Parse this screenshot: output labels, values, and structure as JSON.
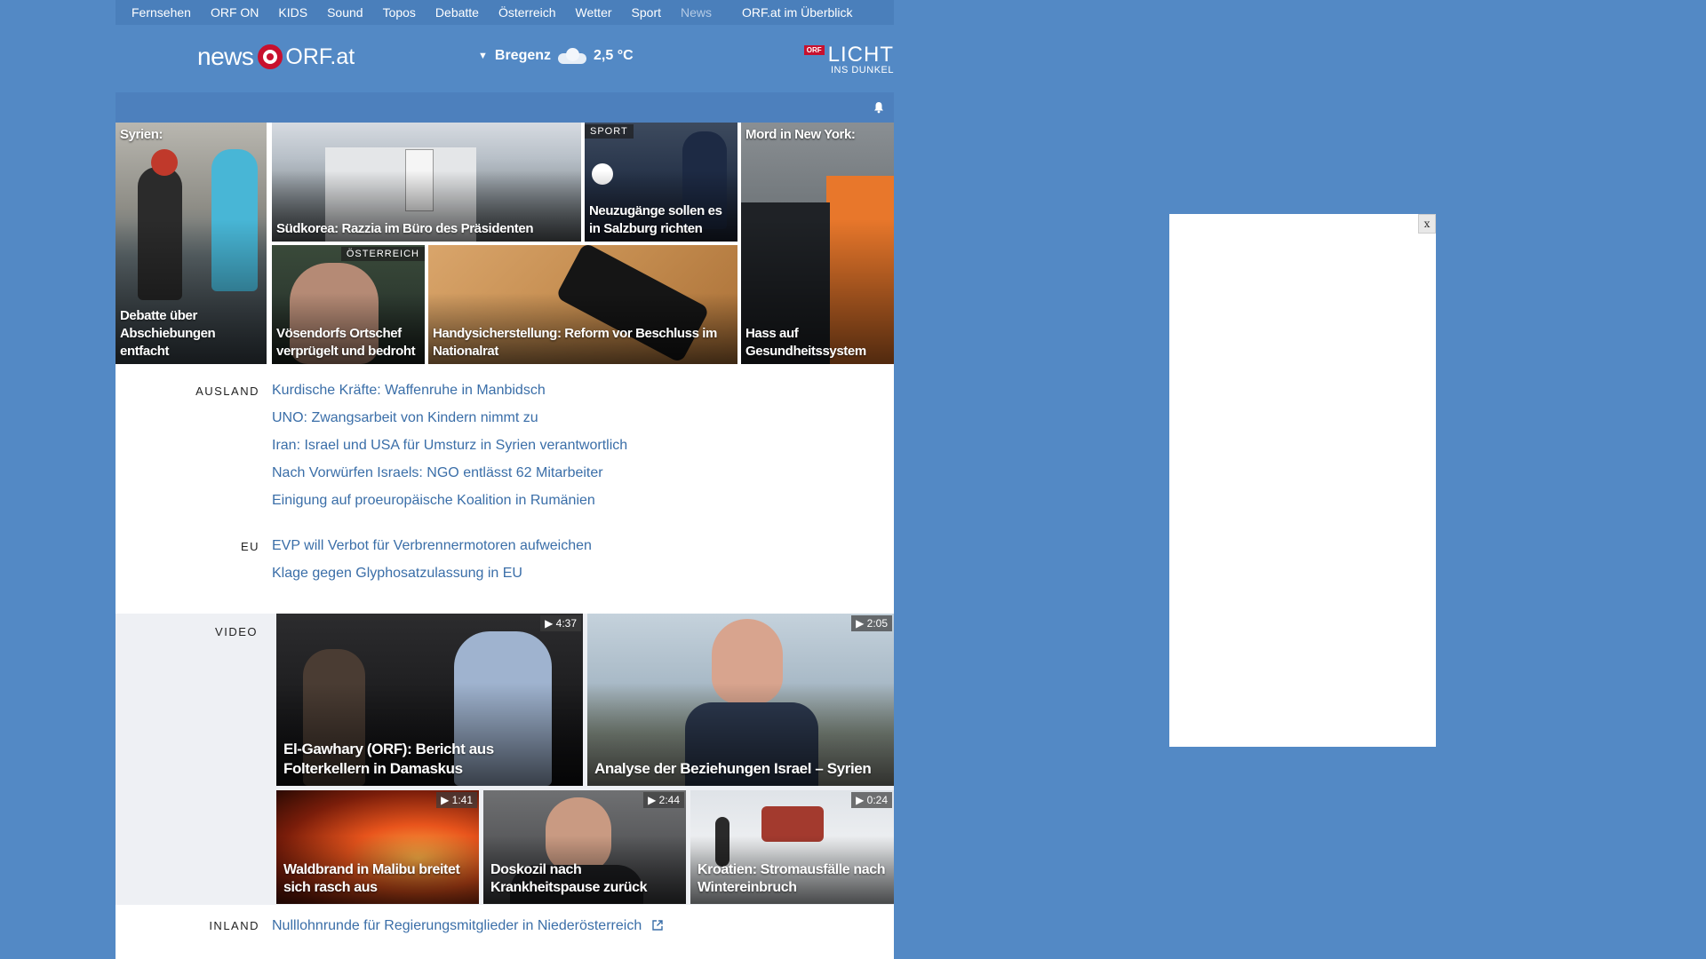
{
  "topnav": {
    "items": [
      {
        "label": "Fernsehen"
      },
      {
        "label": "ORF ON"
      },
      {
        "label": "KIDS"
      },
      {
        "label": "Sound"
      },
      {
        "label": "Topos"
      },
      {
        "label": "Debatte"
      },
      {
        "label": "Österreich"
      },
      {
        "label": "Wetter"
      },
      {
        "label": "Sport"
      },
      {
        "label": "News"
      }
    ],
    "overview": "ORF.at im Überblick"
  },
  "header": {
    "logo_news": "news",
    "logo_orf": "ORF.at",
    "location": "Bregenz",
    "temperature": "2,5 °C",
    "licht_badge": "ORF",
    "licht_title": "LICHT",
    "licht_subtitle": "INS DUNKEL"
  },
  "teasers": [
    {
      "top": "Syrien:",
      "caption": "Debatte über Abschiebungen entfacht"
    },
    {
      "caption": "Südkorea: Razzia im Büro des Präsidenten"
    },
    {
      "tag": "SPORT",
      "caption": "Neuzugänge sollen es in Salzburg richten"
    },
    {
      "top": "Mord in New York:",
      "caption": "Hass auf Gesundheitssystem"
    },
    {
      "tag": "ÖSTERREICH",
      "caption": "Vösendorfs Ortschef verprügelt und bedroht"
    },
    {
      "caption": "Handysicherstellung: Reform vor Beschluss im Nationalrat"
    }
  ],
  "ausland": {
    "label": "AUSLAND",
    "items": [
      "Kurdische Kräfte: Waffenruhe in Manbidsch",
      "UNO: Zwangsarbeit von Kindern nimmt zu",
      "Iran: Israel und USA für Umsturz in Syrien verantwortlich",
      "Nach Vorwürfen Israels: NGO entlässt 62 Mitarbeiter",
      "Einigung auf proeuropäische Koalition in Rumänien"
    ]
  },
  "eu": {
    "label": "EU",
    "items": [
      "EVP will Verbot für Verbrennermotoren aufweichen",
      "Klage gegen Glyphosatzulassung in EU"
    ]
  },
  "video": {
    "label": "VIDEO",
    "items": [
      {
        "duration": "▶ 4:37",
        "caption": "El-Gawhary (ORF): Bericht aus Folterkellern in Damaskus"
      },
      {
        "duration": "▶ 2:05",
        "caption": "Analyse der Beziehungen Israel – Syrien"
      },
      {
        "duration": "▶ 1:41",
        "caption": "Waldbrand in Malibu breitet sich rasch aus"
      },
      {
        "duration": "▶ 2:44",
        "caption": "Doskozil nach Krankheitspause zurück"
      },
      {
        "duration": "▶ 0:24",
        "caption": "Kroatien: Stromausfälle nach Wintereinbruch"
      }
    ]
  },
  "inland": {
    "label": "INLAND",
    "items": [
      "Nulllohnrunde für Regierungsmitglieder in Niederösterreich"
    ]
  },
  "ad": {
    "close_label": "x"
  }
}
